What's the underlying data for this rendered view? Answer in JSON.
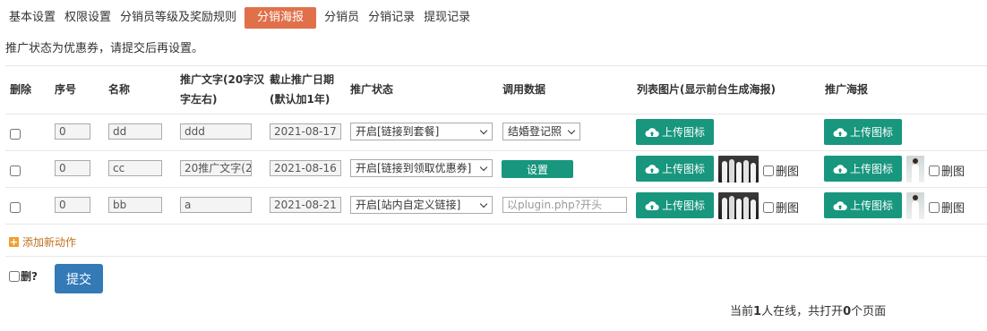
{
  "nav": {
    "items": [
      {
        "label": "基本设置"
      },
      {
        "label": "权限设置"
      },
      {
        "label": "分销员等级及奖励规则"
      },
      {
        "label": "分销海报"
      },
      {
        "label": "分销员"
      },
      {
        "label": "分销记录"
      },
      {
        "label": "提现记录"
      }
    ],
    "active": "分销海报"
  },
  "notice": "推广状态为优惠券，请提交后再设置。",
  "table": {
    "headers": {
      "delete": "删除",
      "index": "序号",
      "name": "名称",
      "promo_text_1": "推广文字(20字汉",
      "promo_text_2": "字左右)",
      "deadline_1": "截止推广日期",
      "deadline_2": "(默认加1年)",
      "status": "推广状态",
      "call_data": "调用数据",
      "list_image": "列表图片(显示前台生成海报)",
      "poster": "推广海报"
    },
    "rows": [
      {
        "index": "0",
        "name": "dd",
        "promo_text": "ddd",
        "deadline": "2021-08-17",
        "status": "开启[链接到套餐]",
        "call_data_select": "结婚登记照",
        "list_image_btn": "上传图标",
        "poster_btn": "上传图标"
      },
      {
        "index": "0",
        "name": "cc",
        "promo_text": "20推广文字(2",
        "deadline": "2021-08-16",
        "status": "开启[链接到领取优惠券]",
        "call_data_button": "设置",
        "list_image_btn": "上传图标",
        "list_image_del": "删图",
        "poster_btn": "上传图标",
        "poster_del": "删图"
      },
      {
        "index": "0",
        "name": "bb",
        "promo_text": "a",
        "deadline": "2021-08-21",
        "status": "开启[站内自定义链接]",
        "call_data_placeholder": "以plugin.php?开头",
        "list_image_btn": "上传图标",
        "list_image_del": "删图",
        "poster_btn": "上传图标",
        "poster_del": "删图"
      }
    ]
  },
  "add_action": "添加新动作",
  "delete_question": "删?",
  "submit": "提交",
  "footer": {
    "prefix": "当前",
    "online": "1",
    "mid": "人在线，共打开",
    "pages": "0",
    "suffix": "个页面"
  },
  "colors": {
    "accent": "#e0704a",
    "upload": "#18967e",
    "submit": "#337ab7"
  }
}
